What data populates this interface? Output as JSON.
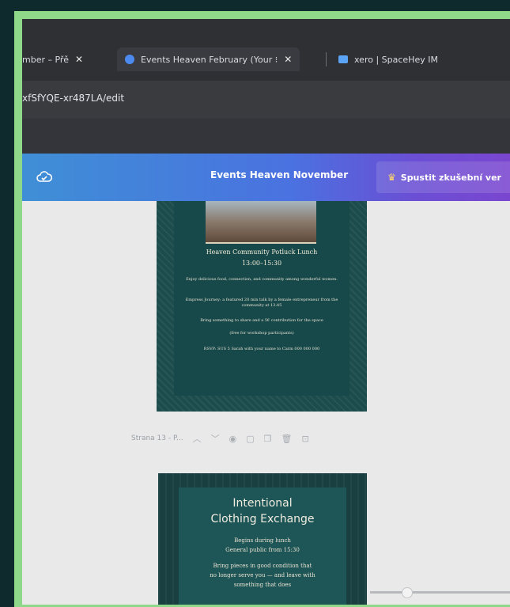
{
  "browser": {
    "tabs": [
      {
        "label": "mber – Přě",
        "close": "✕"
      },
      {
        "label": "Events Heaven February (Your ⁝",
        "close": "✕"
      },
      {
        "label": "xero | SpaceHey IM"
      }
    ],
    "url": "xfSfYQE-xr487LA/edit"
  },
  "app": {
    "doc_title": "Events Heaven November",
    "trial_button": "Spustit zkušební ver"
  },
  "page1": {
    "title": "Heaven Community Potluck Lunch",
    "time": "13:00–15:30",
    "p1": "Enjoy delicious food, connection, and community among wonderful women.",
    "p2": "Empress Journey: a featured 20 min talk by a female entrepreneur from the community at 13:45",
    "p3": "Bring something to share and a 5€ contribution for the space",
    "p4": "(free for workshop participants)",
    "p5": "RSVP: SUS 5 Sarah with your name to Carm 000 000 000"
  },
  "page_toolbar": {
    "label": "Strana 13 - P..."
  },
  "page2": {
    "title_line1": "Intentional",
    "title_line2": "Clothing Exchange",
    "line1": "Begins during lunch",
    "line2": "General public from 15:30",
    "line3": "Bring pieces in good condition that",
    "line4": "no longer serve you — and leave with",
    "line5": "something that does"
  },
  "colors": {
    "frame": "#8fd88a",
    "appbar_start": "#3f8fd6",
    "appbar_end": "#7a46d0",
    "poster_bg": "#1d4c4c"
  }
}
